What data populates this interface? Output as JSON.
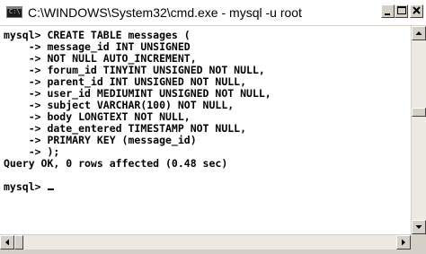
{
  "window": {
    "title": "C:\\WINDOWS\\System32\\cmd.exe - mysql -u root",
    "icon": "console-icon",
    "controls": {
      "minimize_icon": "minimize-icon",
      "maximize_icon": "maximize-icon",
      "close_icon": "close-icon"
    }
  },
  "console": {
    "lines": [
      "mysql> CREATE TABLE messages (",
      "    -> message_id INT UNSIGNED",
      "    -> NOT NULL AUTO_INCREMENT,",
      "    -> forum_id TINYINT UNSIGNED NOT NULL,",
      "    -> parent_id INT UNSIGNED NOT NULL,",
      "    -> user_id MEDIUMINT UNSIGNED NOT NULL,",
      "    -> subject VARCHAR(100) NOT NULL,",
      "    -> body LONGTEXT NOT NULL,",
      "    -> date_entered TIMESTAMP NOT NULL,",
      "    -> PRIMARY KEY (message_id)",
      "    -> );",
      "Query OK, 0 rows affected (0.48 sec)",
      "",
      "mysql> "
    ]
  },
  "scrollbars": {
    "vertical": {
      "up_icon": "arrow-up-icon",
      "down_icon": "arrow-down-icon"
    },
    "horizontal": {
      "left_icon": "arrow-left-icon",
      "right_icon": "arrow-right-icon"
    }
  },
  "colors": {
    "console_bg": "#ffffff",
    "console_text": "#000000",
    "chrome": "#d4d0c8"
  }
}
